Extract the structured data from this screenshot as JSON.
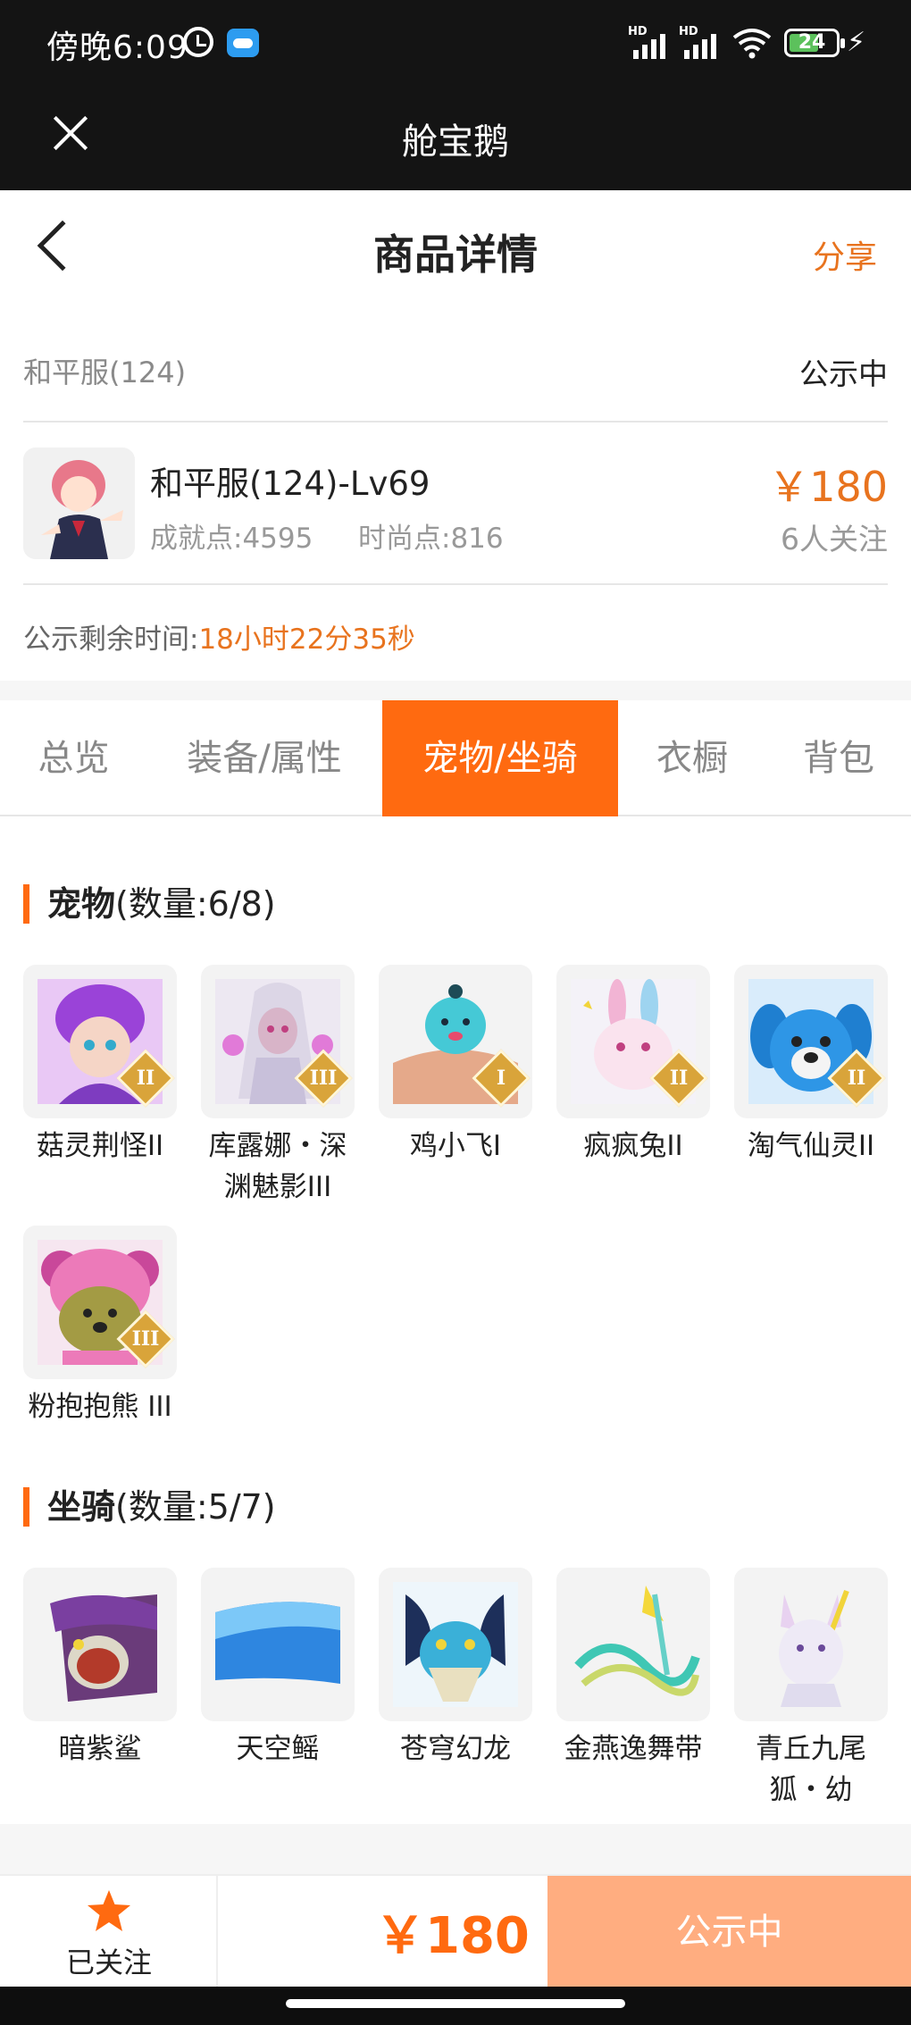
{
  "status_bar": {
    "time": "傍晚6:09",
    "battery": "24",
    "network_tag": "HD"
  },
  "app_bar": {
    "title": "舱宝鹅"
  },
  "header": {
    "title": "商品详情",
    "share": "分享"
  },
  "listing": {
    "server": "和平服(124)",
    "status": "公示中",
    "name": "和平服(124)-Lv69",
    "achievement": "成就点:4595",
    "fashion": "时尚点:816",
    "price": "￥180",
    "followers": "6人关注",
    "remaining_label": "公示剩余时间:",
    "remaining_value": "18小时22分35秒"
  },
  "tabs": [
    {
      "label": "总览",
      "active": false
    },
    {
      "label": "装备/属性",
      "active": false
    },
    {
      "label": "宠物/坐骑",
      "active": true
    },
    {
      "label": "衣橱",
      "active": false
    },
    {
      "label": "背包",
      "active": false
    }
  ],
  "pets": {
    "title": "宠物",
    "count": "(数量:6/8)",
    "items": [
      {
        "name": "菇灵荆怪II",
        "badge": "II"
      },
      {
        "name": "库露娜・深渊魅影III",
        "badge": "III"
      },
      {
        "name": "鸡小飞I",
        "badge": "I"
      },
      {
        "name": "疯疯兔II",
        "badge": "II"
      },
      {
        "name": "淘气仙灵II",
        "badge": "II"
      },
      {
        "name": "粉抱抱熊 III",
        "badge": "III"
      }
    ]
  },
  "mounts": {
    "title": "坐骑",
    "count": "(数量:5/7)",
    "items": [
      {
        "name": "暗紫鲨"
      },
      {
        "name": "天空鳐"
      },
      {
        "name": "苍穹幻龙"
      },
      {
        "name": "金燕逸舞带"
      },
      {
        "name": "青丘九尾狐・幼"
      }
    ]
  },
  "bottom": {
    "follow_label": "已关注",
    "price": "￥180",
    "action": "公示中"
  },
  "colors": {
    "accent": "#ff6a10",
    "price": "#e8731e",
    "action_bg": "#ffad80"
  }
}
